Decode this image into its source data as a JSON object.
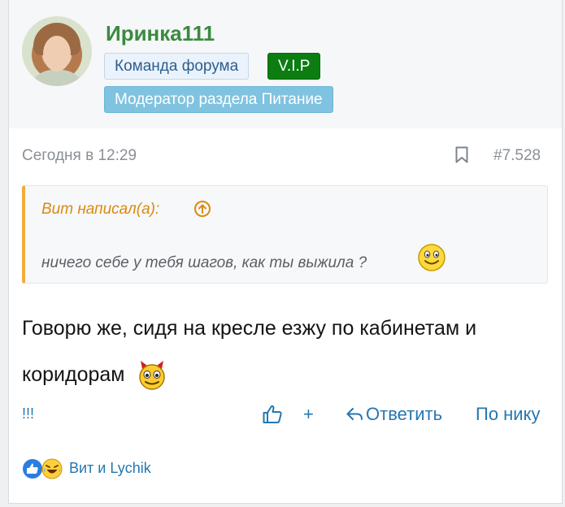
{
  "user": {
    "name": "Иринка111",
    "badges": {
      "team": "Команда форума",
      "vip": "V.I.P",
      "moderator": "Модератор раздела Питание"
    }
  },
  "meta": {
    "date": "Сегодня в 12:29",
    "post_number": "#7.528"
  },
  "quote": {
    "author": "Вит написал(а):",
    "text": "ничего себе у тебя шагов, как ты выжила ?"
  },
  "message": {
    "text": "Говорю же, сидя на кресле езжу по кабинетам и коридорам"
  },
  "footer": {
    "signature": "!!!",
    "plus": "+",
    "reply": "Ответить",
    "by_nick": "По нику"
  },
  "reactions": {
    "names": "Вит и Lychik"
  },
  "colors": {
    "username": "#3a8a3f",
    "link": "#2577b1",
    "quote_accent": "#f0ad3c",
    "vip": "#0b7d11",
    "moderator": "#7fc3e0"
  }
}
